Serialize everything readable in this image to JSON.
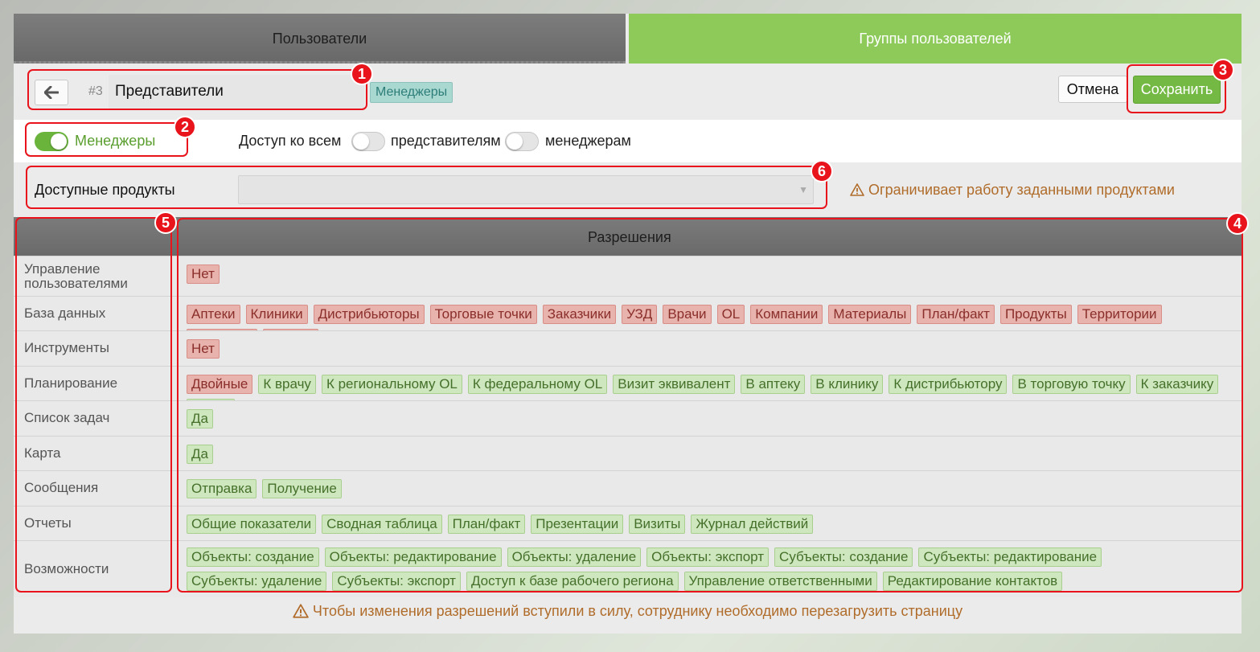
{
  "tabs": {
    "users": "Пользователи",
    "groups": "Группы пользователей"
  },
  "group": {
    "id": "#3",
    "name": "Представители",
    "parent_tag": "Менеджеры"
  },
  "buttons": {
    "cancel": "Отмена",
    "save": "Сохранить"
  },
  "role": {
    "label": "Менеджеры",
    "enabled": true
  },
  "access": {
    "prefix": "Доступ ко всем",
    "representatives": "представителям",
    "managers": "менеджерам",
    "representatives_on": false,
    "managers_on": false
  },
  "products": {
    "label": "Доступные продукты",
    "value": "",
    "warning": "Ограничивает работу заданными продуктами"
  },
  "permissions": {
    "header": "Разрешения",
    "rows": [
      {
        "name": "Управление пользователями",
        "tags": [
          {
            "t": "Нет",
            "s": "red"
          }
        ]
      },
      {
        "name": "База данных",
        "tags": [
          {
            "t": "Аптеки",
            "s": "red"
          },
          {
            "t": "Клиники",
            "s": "red"
          },
          {
            "t": "Дистрибьюторы",
            "s": "red"
          },
          {
            "t": "Торговые точки",
            "s": "red"
          },
          {
            "t": "Заказчики",
            "s": "red"
          },
          {
            "t": "УЗД",
            "s": "red"
          },
          {
            "t": "Врачи",
            "s": "red"
          },
          {
            "t": "OL",
            "s": "red"
          },
          {
            "t": "Компании",
            "s": "red"
          },
          {
            "t": "Материалы",
            "s": "red"
          },
          {
            "t": "План/факт",
            "s": "red"
          },
          {
            "t": "Продукты",
            "s": "red"
          },
          {
            "t": "Территории",
            "s": "red"
          },
          {
            "t": "Договоры",
            "s": "red"
          },
          {
            "t": "Списки",
            "s": "red"
          }
        ]
      },
      {
        "name": "Инструменты",
        "tags": [
          {
            "t": "Нет",
            "s": "red"
          }
        ]
      },
      {
        "name": "Планирование",
        "tags": [
          {
            "t": "Двойные",
            "s": "red"
          },
          {
            "t": "К врачу",
            "s": "green"
          },
          {
            "t": "К региональному OL",
            "s": "green"
          },
          {
            "t": "К федеральному OL",
            "s": "green"
          },
          {
            "t": "Визит эквивалент",
            "s": "green"
          },
          {
            "t": "В аптеку",
            "s": "green"
          },
          {
            "t": "В клинику",
            "s": "green"
          },
          {
            "t": "К дистрибьютору",
            "s": "green"
          },
          {
            "t": "В торговую точку",
            "s": "green"
          },
          {
            "t": "К заказчику",
            "s": "green"
          },
          {
            "t": "В УЗД",
            "s": "green"
          }
        ]
      },
      {
        "name": "Список задач",
        "tags": [
          {
            "t": "Да",
            "s": "green"
          }
        ]
      },
      {
        "name": "Карта",
        "tags": [
          {
            "t": "Да",
            "s": "green"
          }
        ]
      },
      {
        "name": "Сообщения",
        "tags": [
          {
            "t": "Отправка",
            "s": "green"
          },
          {
            "t": "Получение",
            "s": "green"
          }
        ]
      },
      {
        "name": "Отчеты",
        "tags": [
          {
            "t": "Общие показатели",
            "s": "green"
          },
          {
            "t": "Сводная таблица",
            "s": "green"
          },
          {
            "t": "План/факт",
            "s": "green"
          },
          {
            "t": "Презентации",
            "s": "green"
          },
          {
            "t": "Визиты",
            "s": "green"
          },
          {
            "t": "Журнал действий",
            "s": "green"
          }
        ]
      },
      {
        "name": "Возможности",
        "tags": [
          {
            "t": "Объекты: создание",
            "s": "green"
          },
          {
            "t": "Объекты: редактирование",
            "s": "green"
          },
          {
            "t": "Объекты: удаление",
            "s": "green"
          },
          {
            "t": "Объекты: экспорт",
            "s": "green"
          },
          {
            "t": "Субъекты: создание",
            "s": "green"
          },
          {
            "t": "Субъекты: редактирование",
            "s": "green"
          },
          {
            "t": "Субъекты: удаление",
            "s": "green"
          },
          {
            "t": "Субъекты: экспорт",
            "s": "green"
          },
          {
            "t": "Доступ к базе рабочего региона",
            "s": "green"
          },
          {
            "t": "Управление ответственными",
            "s": "green"
          },
          {
            "t": "Редактирование контактов",
            "s": "green"
          }
        ]
      }
    ]
  },
  "footer_warning": "Чтобы изменения разрешений вступили в силу, сотруднику необходимо перезагрузить страницу",
  "annotations": [
    "1",
    "2",
    "3",
    "4",
    "5",
    "6"
  ],
  "colors": {
    "accent_green": "#73b943",
    "annotation_red": "#e8131b",
    "warning": "#b06c2a"
  }
}
